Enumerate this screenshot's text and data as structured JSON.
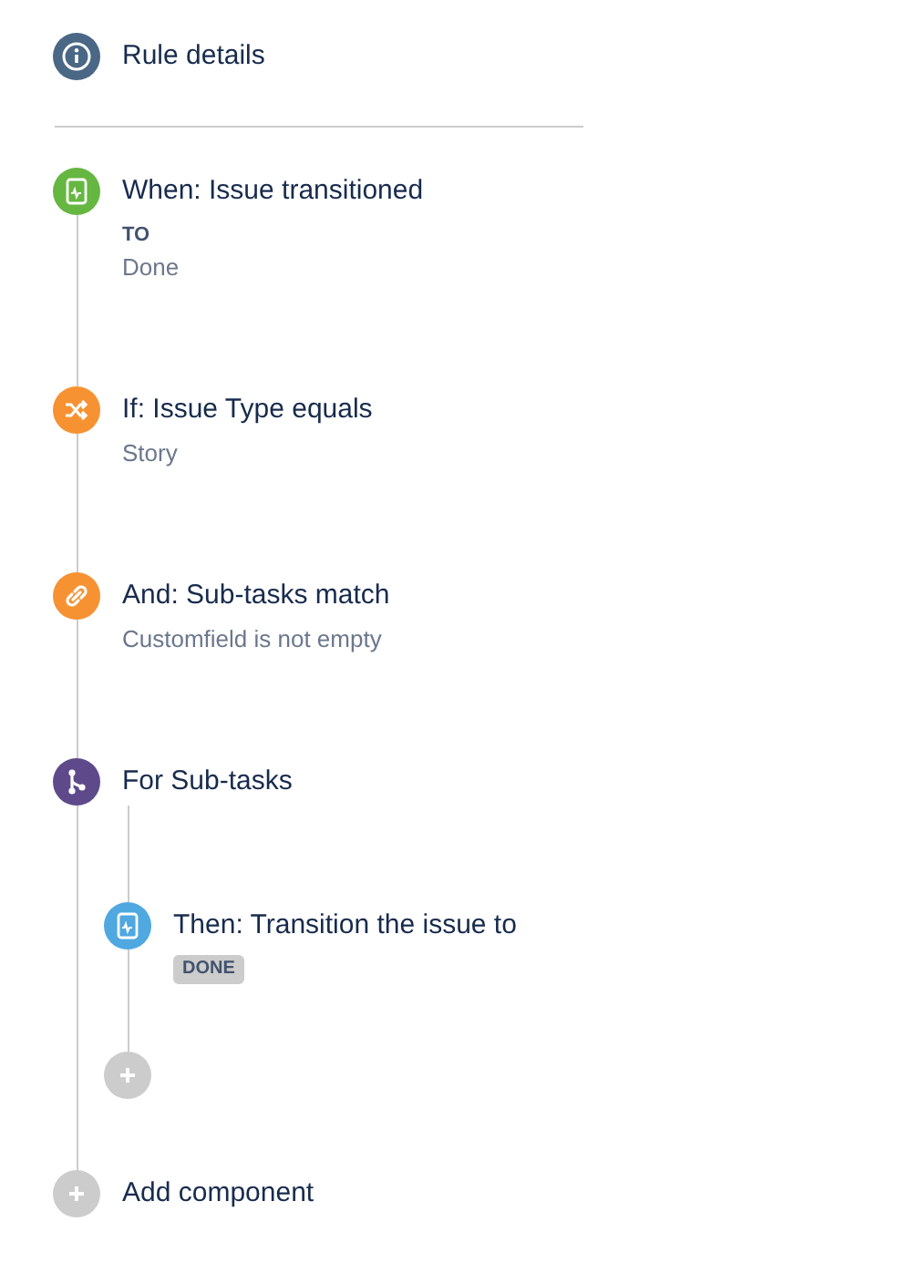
{
  "header": {
    "title": "Rule details"
  },
  "components": [
    {
      "kind": "trigger",
      "title": "When: Issue transitioned",
      "label": "TO",
      "value": "Done"
    },
    {
      "kind": "condition",
      "title": "If: Issue Type equals",
      "value": "Story"
    },
    {
      "kind": "related",
      "title": "And: Sub-tasks match",
      "value": "Customfield is not empty"
    },
    {
      "kind": "branch",
      "title": "For Sub-tasks",
      "children": [
        {
          "kind": "action",
          "title": "Then: Transition the issue to",
          "tag": "DONE"
        },
        {
          "kind": "add"
        }
      ]
    },
    {
      "kind": "add",
      "title": "Add component"
    }
  ]
}
